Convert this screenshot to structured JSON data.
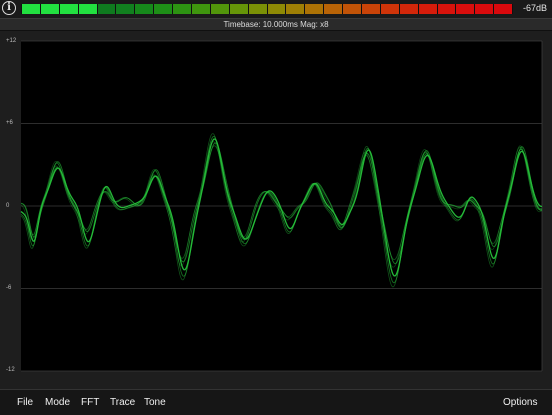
{
  "header": {
    "info_icon": "info-icon",
    "info_glyph": "i",
    "level_meter": {
      "segment_count": 26,
      "lit_segments": 4,
      "colors": [
        "#19c93c",
        "#19c93c",
        "#19c93c",
        "#19c93c",
        "#0f7a1f",
        "#11801f",
        "#16891b",
        "#1e8f17",
        "#2d9312",
        "#3f950e",
        "#52950b",
        "#669508",
        "#7b9106",
        "#8e8a05",
        "#9e7f05",
        "#ac7205",
        "#b86306",
        "#c15307",
        "#c94308",
        "#cf3409",
        "#d3270a",
        "#d61c0b",
        "#d8130c",
        "#d90e0d",
        "#d90b0d",
        "#d9090d"
      ]
    },
    "db_readout": "-67dB"
  },
  "status": {
    "timebase": "Timebase: 10.000ms  Mag: x8"
  },
  "scope": {
    "y_labels": [
      "+12",
      "+6",
      "0",
      "-6",
      "-12"
    ],
    "grid_color": "#3d3d3d",
    "trace_color": "#27c23b",
    "y_range": [
      -12,
      12
    ]
  },
  "menu": {
    "file": "File",
    "mode": "Mode",
    "fft": "FFT",
    "trace": "Trace",
    "tone": "Tone",
    "options": "Options"
  }
}
